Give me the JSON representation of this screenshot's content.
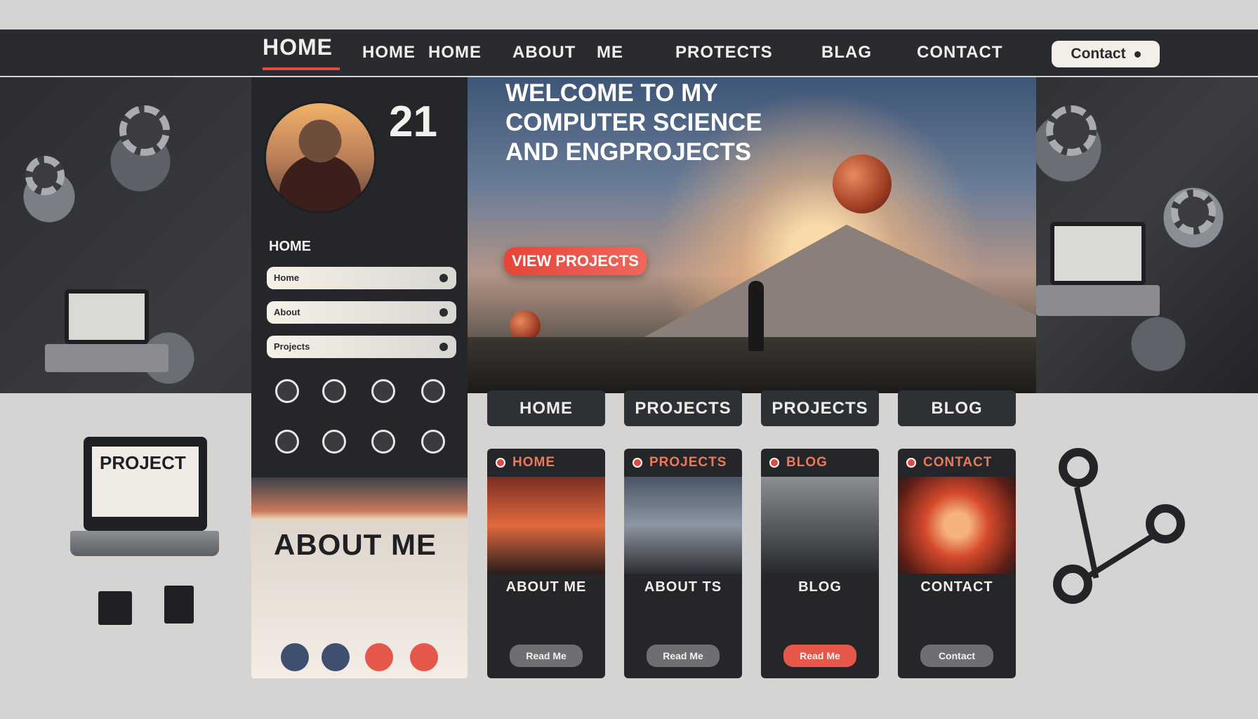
{
  "nav": {
    "items": [
      "HOME",
      "HOME",
      "HOME",
      "ABOUT",
      "ME",
      "PROTECTS",
      "BLAG",
      "CONTACT"
    ],
    "contact_button": "Contact"
  },
  "sidebar": {
    "number": "21",
    "heading": "HOME",
    "fields": [
      "Home",
      "About",
      "Projects"
    ]
  },
  "hero": {
    "title_lines": [
      "WELCOME TO MY",
      "COMPUTER SCIENCE",
      "AND ENGPROJECTS"
    ],
    "cta": "VIEW PROJECTS"
  },
  "tabs": [
    "HOME",
    "PROJECTS",
    "PROJECTS",
    "BLOG"
  ],
  "cards": [
    {
      "header": "HOME",
      "title": "ABOUT ME",
      "button": "Read Me"
    },
    {
      "header": "PROJECTS",
      "title": "ABOUT TS",
      "button": "Read Me"
    },
    {
      "header": "BLOG",
      "title": "BLOG",
      "button": "Read Me"
    },
    {
      "header": "CONTACT",
      "title": "CONTACT",
      "button": "Contact"
    }
  ],
  "about": {
    "title": "ABOUT ME"
  },
  "left_card": {
    "label": "PROJECT"
  },
  "colors": {
    "accent": "#e24a3f",
    "dark": "#24262a",
    "background": "#d6d4d2"
  }
}
